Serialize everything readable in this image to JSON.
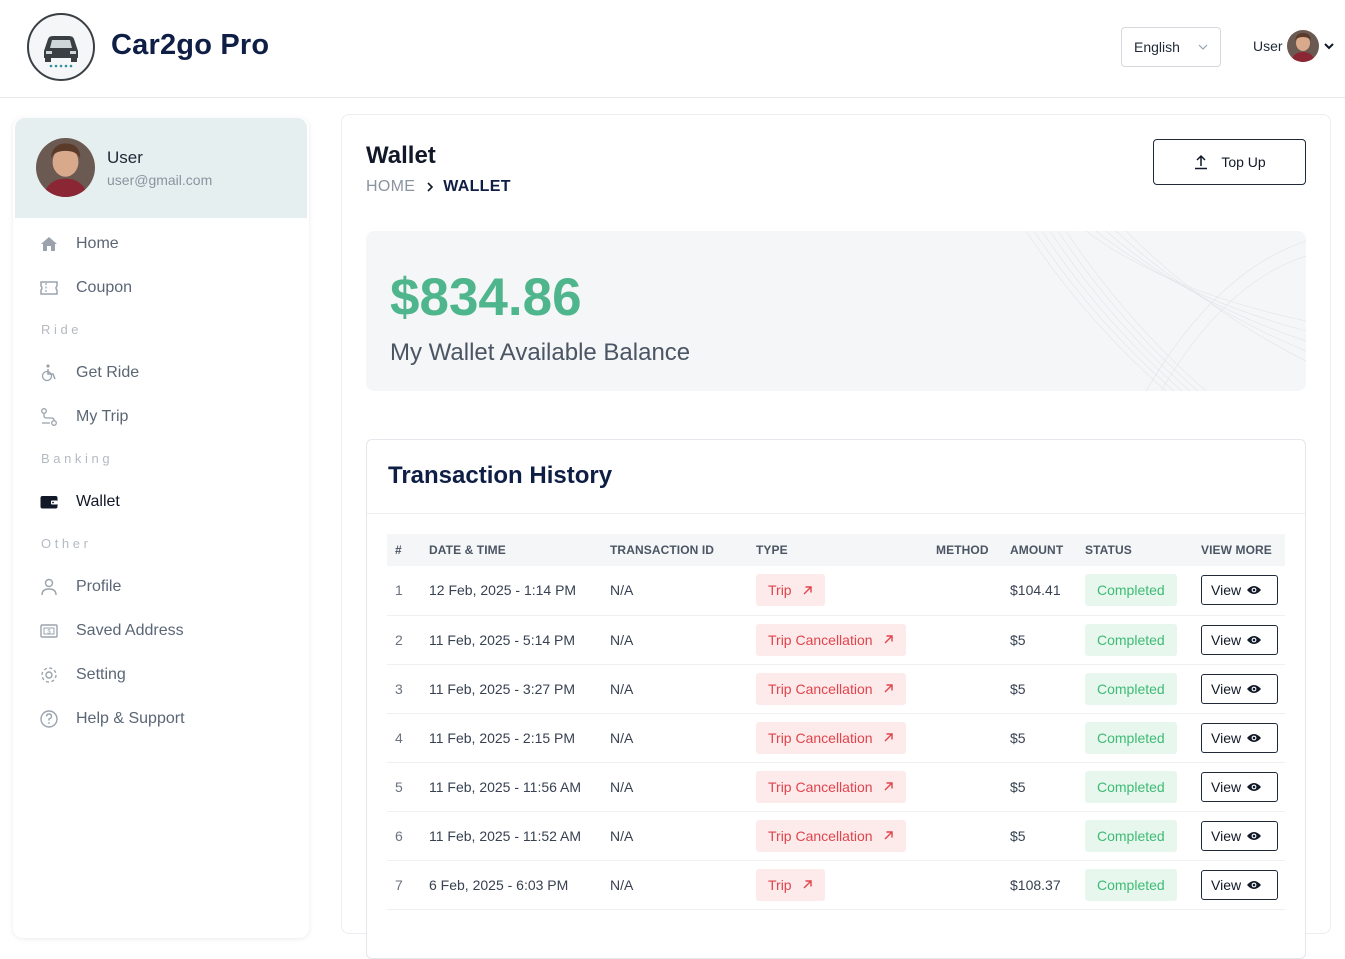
{
  "header": {
    "brand": "Car2go Pro",
    "language": "English",
    "user_label": "User"
  },
  "sidebar": {
    "user_name": "User",
    "user_email": "user@gmail.com",
    "items": [
      {
        "label": "Home",
        "icon": "home-icon"
      },
      {
        "label": "Coupon",
        "icon": "ticket-icon"
      },
      {
        "section": "Ride"
      },
      {
        "label": "Get Ride",
        "icon": "wheelchair-icon"
      },
      {
        "label": "My Trip",
        "icon": "route-icon"
      },
      {
        "section": "Banking"
      },
      {
        "label": "Wallet",
        "icon": "wallet-icon",
        "active": true
      },
      {
        "section": "Other"
      },
      {
        "label": "Profile",
        "icon": "person-icon"
      },
      {
        "label": "Saved Address",
        "icon": "money-card-icon"
      },
      {
        "label": "Setting",
        "icon": "gear-icon"
      },
      {
        "label": "Help & Support",
        "icon": "question-icon"
      }
    ]
  },
  "main": {
    "title": "Wallet",
    "breadcrumb_home": "HOME",
    "breadcrumb_current": "WALLET",
    "topup_label": "Top Up",
    "balance": "$834.86",
    "balance_label": "My Wallet Available Balance",
    "accent_color": "#4fb58c"
  },
  "transactions": {
    "title": "Transaction History",
    "columns": [
      "#",
      "DATE & TIME",
      "TRANSACTION ID",
      "TYPE",
      "METHOD",
      "AMOUNT",
      "STATUS",
      "VIEW MORE"
    ],
    "view_label": "View",
    "rows": [
      {
        "n": "1",
        "date": "12 Feb, 2025 - 1:14 PM",
        "id": "N/A",
        "type": "Trip",
        "method": "",
        "amount": "$104.41",
        "status": "Completed"
      },
      {
        "n": "2",
        "date": "11 Feb, 2025 - 5:14 PM",
        "id": "N/A",
        "type": "Trip Cancellation",
        "method": "",
        "amount": "$5",
        "status": "Completed"
      },
      {
        "n": "3",
        "date": "11 Feb, 2025 - 3:27 PM",
        "id": "N/A",
        "type": "Trip Cancellation",
        "method": "",
        "amount": "$5",
        "status": "Completed"
      },
      {
        "n": "4",
        "date": "11 Feb, 2025 - 2:15 PM",
        "id": "N/A",
        "type": "Trip Cancellation",
        "method": "",
        "amount": "$5",
        "status": "Completed"
      },
      {
        "n": "5",
        "date": "11 Feb, 2025 - 11:56 AM",
        "id": "N/A",
        "type": "Trip Cancellation",
        "method": "",
        "amount": "$5",
        "status": "Completed"
      },
      {
        "n": "6",
        "date": "11 Feb, 2025 - 11:52 AM",
        "id": "N/A",
        "type": "Trip Cancellation",
        "method": "",
        "amount": "$5",
        "status": "Completed"
      },
      {
        "n": "7",
        "date": "6 Feb, 2025 - 6:03 PM",
        "id": "N/A",
        "type": "Trip",
        "method": "",
        "amount": "$108.37",
        "status": "Completed"
      }
    ]
  }
}
